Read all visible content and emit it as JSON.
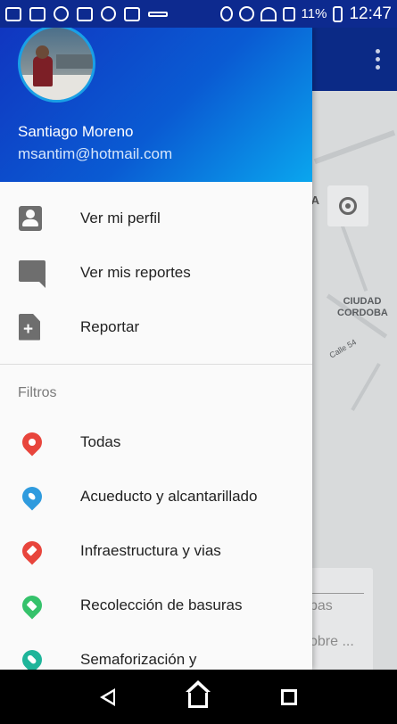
{
  "status_bar": {
    "battery_percent": "11%",
    "time": "12:47",
    "icons": [
      "messages-icon",
      "gmail-icon",
      "app-icon",
      "image-icon",
      "bulb-icon",
      "usb-icon",
      "key-icon",
      "location-icon",
      "dnd-icon",
      "wifi-icon",
      "no-signal-icon",
      "battery-icon"
    ]
  },
  "drawer": {
    "user": {
      "name": "Santiago Moreno",
      "email": "msantim@hotmail.com"
    },
    "actions": [
      {
        "label": "Ver mi perfil",
        "icon": "profile-icon"
      },
      {
        "label": "Ver mis reportes",
        "icon": "chat-icon"
      },
      {
        "label": "Reportar",
        "icon": "add-document-icon"
      }
    ],
    "filters_title": "Filtros",
    "filters": [
      {
        "label": "Todas",
        "icon": "pin-red-icon",
        "color": "#e8453c"
      },
      {
        "label": "Acueducto y alcantarillado",
        "icon": "pin-water-icon",
        "color": "#2f9bde"
      },
      {
        "label": "Infraestructura y vias",
        "icon": "pin-book-icon",
        "color": "#e8453c"
      },
      {
        "label": "Recolección de basuras",
        "icon": "pin-trash-icon",
        "color": "#35c26b"
      },
      {
        "label": "Semaforización y",
        "icon": "pin-traffic-light-icon",
        "color": "#1fb59a"
      }
    ]
  },
  "background_app": {
    "map_labels": [
      "CIUDAD CORDOBA"
    ],
    "map_partial_label": "IA",
    "street_label": "Calle 54",
    "card_text": [
      "pas",
      ".",
      "obre ..."
    ]
  },
  "colors": {
    "header_start": "#1036c0",
    "header_end": "#0aa6ee",
    "toolbar": "#0b2a86"
  }
}
